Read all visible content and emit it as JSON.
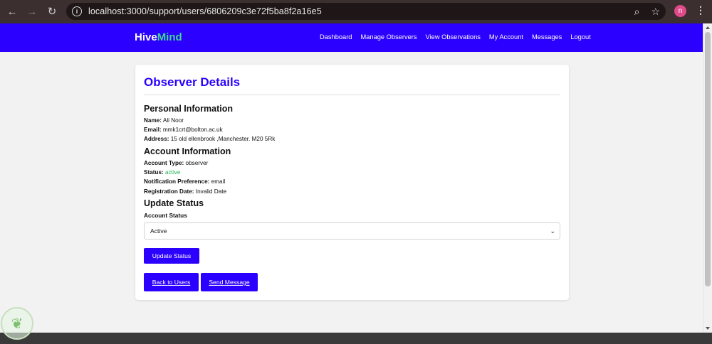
{
  "browser": {
    "url": "localhost:3000/support/users/6806209c3e72f5ba8f2a16e5",
    "profile_initial": "n"
  },
  "app": {
    "logo_part1": "Hive",
    "logo_part2": "Mind",
    "nav": [
      "Dashboard",
      "Manage Observers",
      "View Observations",
      "My Account",
      "Messages",
      "Logout"
    ]
  },
  "page": {
    "title": "Observer Details",
    "personal": {
      "heading": "Personal Information",
      "name_label": "Name:",
      "name": "Ali Noor",
      "email_label": "Email:",
      "email": "mmk1crt@bolton.ac.uk",
      "address_label": "Address:",
      "address": "15 old ellenbrook ,Manchester. M20 5Rk"
    },
    "account": {
      "heading": "Account Information",
      "type_label": "Account Type:",
      "type": "observer",
      "status_label": "Status:",
      "status": "active",
      "notif_label": "Notification Preference:",
      "notif": "email",
      "reg_label": "Registration Date:",
      "reg": "Invalid Date"
    },
    "update": {
      "heading": "Update Status",
      "field_label": "Account Status",
      "selected": "Active",
      "button": "Update Status"
    },
    "actions": {
      "back": "Back to Users",
      "message": "Send Message"
    }
  },
  "colors": {
    "brand": "#2b00ff",
    "accent": "#40d890",
    "status_active": "#22b450"
  }
}
